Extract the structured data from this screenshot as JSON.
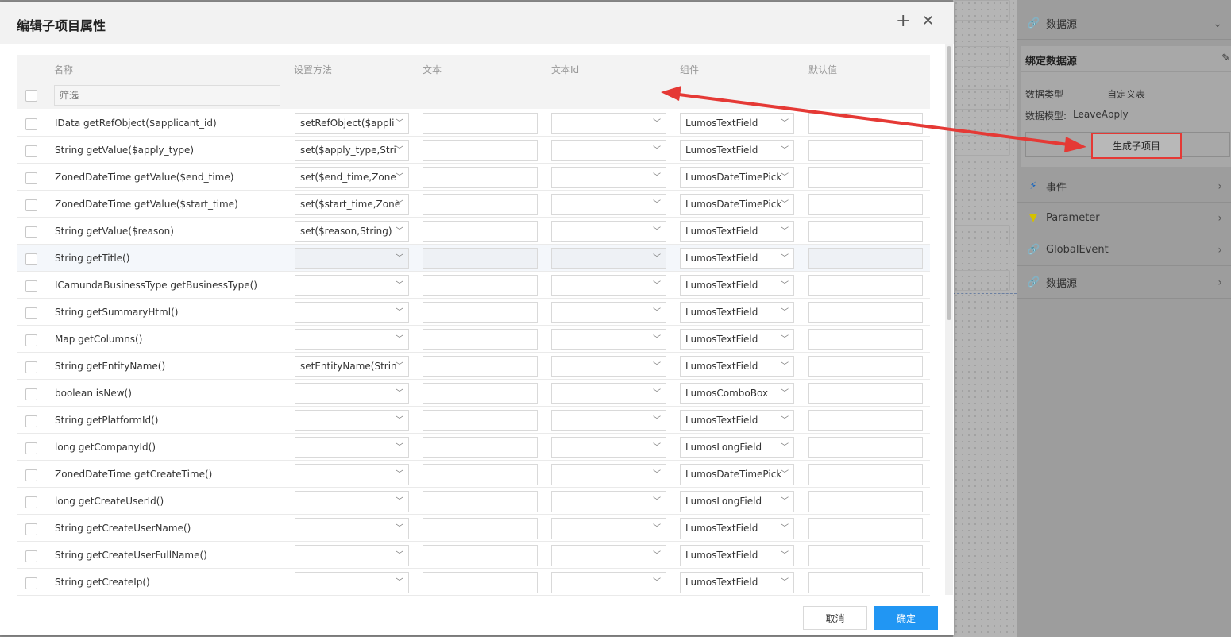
{
  "dialog": {
    "title": "编辑子项目属性",
    "columns": {
      "name": "名称",
      "method": "设置方法",
      "text": "文本",
      "text_id": "文本Id",
      "component": "组件",
      "default": "默认值"
    },
    "filter_placeholder": "筛选",
    "rows": [
      {
        "name": "IData getRefObject($applicant_id)",
        "method": "setRefObject($appli",
        "component": "LumosTextField"
      },
      {
        "name": "String getValue($apply_type)",
        "method": "set($apply_type,Stri",
        "component": "LumosTextField"
      },
      {
        "name": "ZonedDateTime getValue($end_time)",
        "method": "set($end_time,Zone",
        "component": "LumosDateTimePick"
      },
      {
        "name": "ZonedDateTime getValue($start_time)",
        "method": "set($start_time,Zone",
        "component": "LumosDateTimePick"
      },
      {
        "name": "String getValue($reason)",
        "method": "set($reason,String)",
        "component": "LumosTextField"
      },
      {
        "name": "String getTitle()",
        "method": "",
        "component": "LumosTextField"
      },
      {
        "name": "ICamundaBusinessType getBusinessType()",
        "method": "",
        "component": "LumosTextField"
      },
      {
        "name": "String getSummaryHtml()",
        "method": "",
        "component": "LumosTextField"
      },
      {
        "name": "Map getColumns()",
        "method": "",
        "component": "LumosTextField"
      },
      {
        "name": "String getEntityName()",
        "method": "setEntityName(Strin",
        "component": "LumosTextField"
      },
      {
        "name": "boolean isNew()",
        "method": "",
        "component": "LumosComboBox"
      },
      {
        "name": "String getPlatformId()",
        "method": "",
        "component": "LumosTextField"
      },
      {
        "name": "long getCompanyId()",
        "method": "",
        "component": "LumosLongField"
      },
      {
        "name": "ZonedDateTime getCreateTime()",
        "method": "",
        "component": "LumosDateTimePick"
      },
      {
        "name": "long getCreateUserId()",
        "method": "",
        "component": "LumosLongField"
      },
      {
        "name": "String getCreateUserName()",
        "method": "",
        "component": "LumosTextField"
      },
      {
        "name": "String getCreateUserFullName()",
        "method": "",
        "component": "LumosTextField"
      },
      {
        "name": "String getCreateIp()",
        "method": "",
        "component": "LumosTextField"
      }
    ],
    "cancel_label": "取消",
    "ok_label": "确定"
  },
  "right_panel": {
    "top_item": "数据源",
    "bind_title": "绑定数据源",
    "data_type_label": "数据类型",
    "data_type_value": "自定义表",
    "data_model_label": "数据模型:",
    "data_model_value": "LeaveApply",
    "generate_button": "生成子项目",
    "items": [
      {
        "label": "事件",
        "icon": "lightning-icon",
        "color": "#1565c0"
      },
      {
        "label": "Parameter",
        "icon": "paint-roller-icon",
        "color": "#d4c100"
      },
      {
        "label": "GlobalEvent",
        "icon": "link-icon",
        "color": "#7b1fa2"
      },
      {
        "label": "数据源",
        "icon": "link-icon",
        "color": "#c98a8a"
      }
    ]
  },
  "colors": {
    "primary": "#2196f3",
    "annotation_red": "#e53935"
  }
}
